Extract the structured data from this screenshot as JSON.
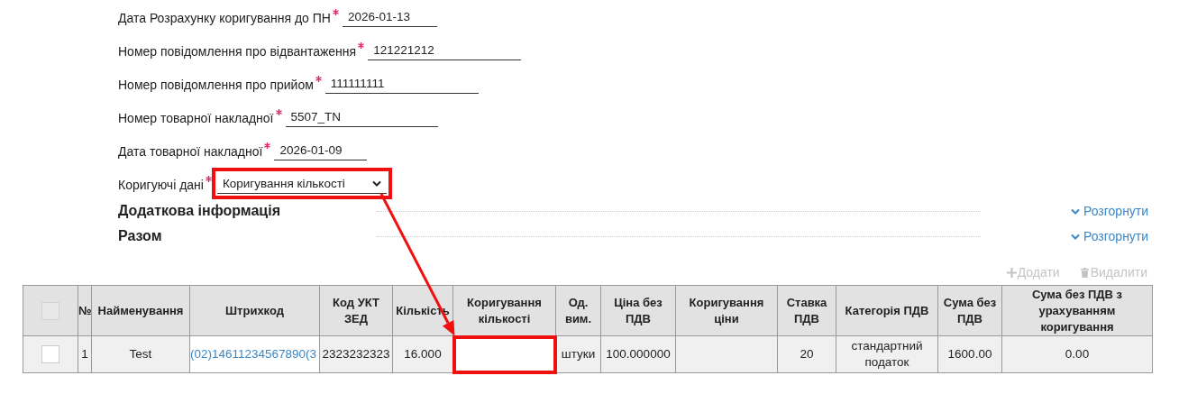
{
  "form": {
    "fields": [
      {
        "label": "Дата Розрахунку коригування до ПН",
        "required": true,
        "kind": "text",
        "value": "2026-01-13"
      },
      {
        "label": "Номер повідомлення про відвантаження",
        "required": true,
        "kind": "text",
        "value": "121221212"
      },
      {
        "label": "Номер повідомлення про прийом",
        "required": true,
        "kind": "text",
        "value": "111111111"
      },
      {
        "label": "Номер товарної накладної",
        "required": true,
        "kind": "text",
        "value": "5507_TN"
      },
      {
        "label": "Дата товарної накладної",
        "required": true,
        "kind": "text",
        "value": "2026-01-09"
      },
      {
        "label": "Коригуючі дані",
        "required": true,
        "kind": "select",
        "value": "Коригування кількості",
        "highlighted": true
      }
    ]
  },
  "sections": [
    {
      "title": "Додаткова інформація",
      "toggle": "Розгорнути",
      "expanded": false
    },
    {
      "title": "Разом",
      "toggle": "Розгорнути",
      "expanded": false
    }
  ],
  "toolbar": [
    {
      "label": "Додати",
      "kind": "add",
      "disabled": true
    },
    {
      "label": "Видалити",
      "kind": "delete",
      "disabled": true
    }
  ],
  "table": {
    "select_all": {
      "checked": false,
      "disabled": true
    },
    "columns": [
      "№",
      "Найменування",
      "Штрихкод",
      "Код УКТ ЗЕД",
      "Кількість",
      "Коригування кількості",
      "Од. вим.",
      "Ціна без ПДВ",
      "Коригування ціни",
      "Ставка ПДВ",
      "Категорія ПДВ",
      "Сума без ПДВ",
      "Сума без ПДВ з урахуванням коригування"
    ],
    "rows": [
      {
        "checked": false,
        "cells": [
          {
            "kind": "text",
            "text": "1"
          },
          {
            "kind": "text",
            "text": "Test"
          },
          {
            "kind": "link",
            "text": "(02)14611234567890(3"
          },
          {
            "kind": "text",
            "text": "2323232323"
          },
          {
            "kind": "text",
            "text": "16.000"
          },
          {
            "kind": "edit",
            "highlighted": true
          },
          {
            "kind": "text",
            "text": "штуки"
          },
          {
            "kind": "text",
            "text": "100.000000"
          },
          {
            "kind": "text"
          },
          {
            "kind": "text",
            "text": "20"
          },
          {
            "kind": "text",
            "text": "стандартний податок"
          },
          {
            "kind": "text",
            "text": "1600.00"
          },
          {
            "kind": "text",
            "text": "0.00"
          }
        ]
      }
    ]
  }
}
